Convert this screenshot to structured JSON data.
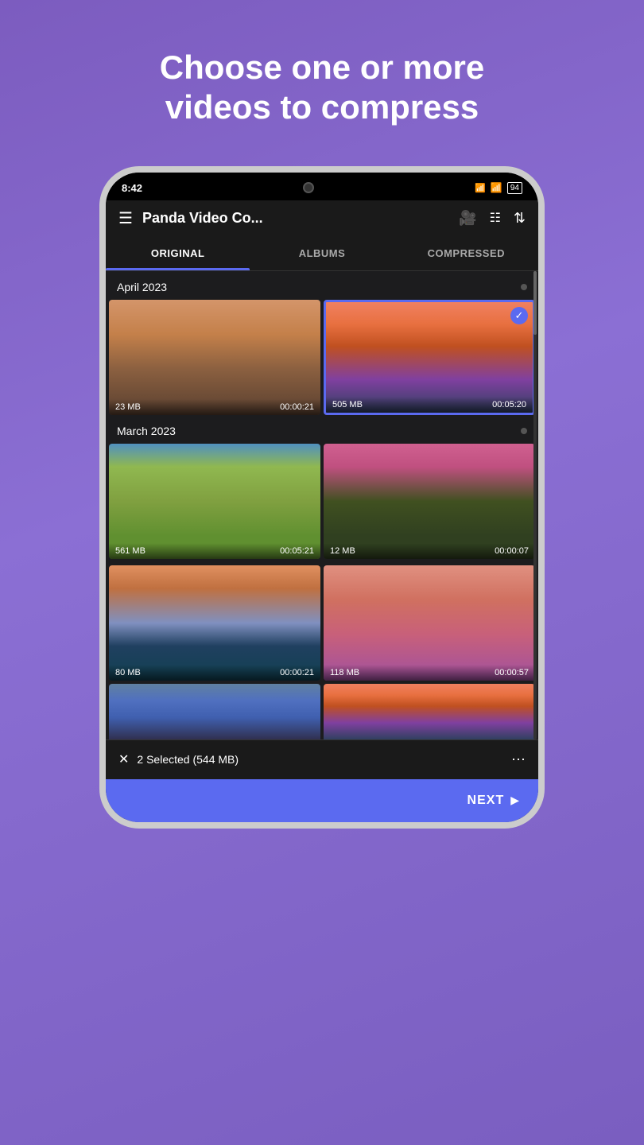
{
  "headline": "Choose one or more\nvideos to compress",
  "status": {
    "time": "8:42"
  },
  "app": {
    "title": "Panda Video Co...",
    "tabs": [
      {
        "id": "original",
        "label": "ORIGINAL",
        "active": true
      },
      {
        "id": "albums",
        "label": "ALBUMS",
        "active": false
      },
      {
        "id": "compressed",
        "label": "COMPRESSED",
        "active": false
      }
    ]
  },
  "sections": [
    {
      "title": "April 2023",
      "videos": [
        {
          "size": "23 MB",
          "duration": "00:00:21",
          "selected": false,
          "bg": "bg-rocks"
        },
        {
          "size": "505 MB",
          "duration": "00:05:20",
          "selected": true,
          "bg": "bg-bridge"
        }
      ]
    },
    {
      "title": "March 2023",
      "videos": [
        {
          "size": "561 MB",
          "duration": "00:05:21",
          "selected": false,
          "bg": "bg-flowers"
        },
        {
          "size": "12 MB",
          "duration": "00:00:07",
          "selected": false,
          "bg": "bg-hills"
        },
        {
          "size": "80 MB",
          "duration": "00:00:21",
          "selected": false,
          "bg": "bg-city"
        },
        {
          "size": "118 MB",
          "duration": "00:00:57",
          "selected": false,
          "bg": "bg-people"
        }
      ]
    }
  ],
  "partialVideos": [
    {
      "bg": "bg-landscape7"
    },
    {
      "bg": "bg-bridge"
    }
  ],
  "selectionBar": {
    "text": "2 Selected (544 MB)"
  },
  "nextButton": {
    "label": "NEXT"
  }
}
